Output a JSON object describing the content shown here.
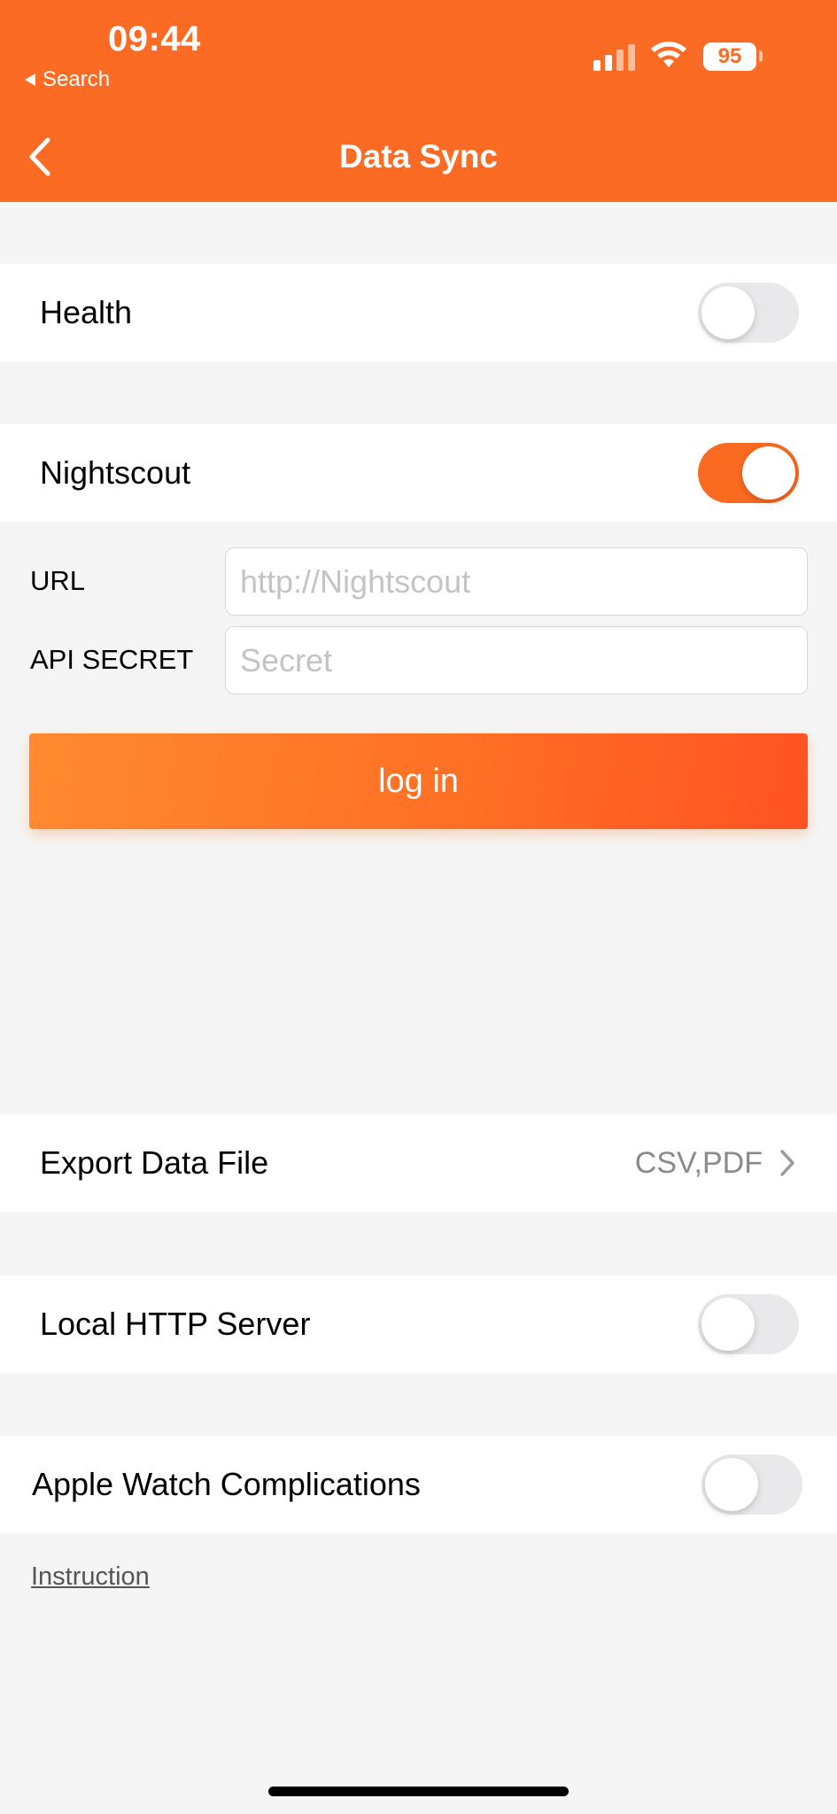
{
  "status_bar": {
    "time": "09:44",
    "back_app": "Search",
    "battery": "95"
  },
  "nav": {
    "title": "Data Sync",
    "back_icon": "chevron-left-icon"
  },
  "health": {
    "label": "Health",
    "enabled": false
  },
  "nightscout": {
    "label": "Nightscout",
    "enabled": true,
    "url_label": "URL",
    "url_placeholder": "http://Nightscout",
    "url_value": "",
    "secret_label": "API SECRET",
    "secret_placeholder": "Secret",
    "secret_value": "",
    "login_label": "log in"
  },
  "export": {
    "label": "Export Data File",
    "value": "CSV,PDF"
  },
  "local_server": {
    "label": "Local HTTP Server",
    "enabled": false
  },
  "apple_watch": {
    "label": "Apple Watch Complications",
    "enabled": false
  },
  "instruction_link": "Instruction",
  "colors": {
    "accent": "#fc6b23",
    "toggle_off": "#e9e9eb",
    "background": "#f5f5f5"
  }
}
